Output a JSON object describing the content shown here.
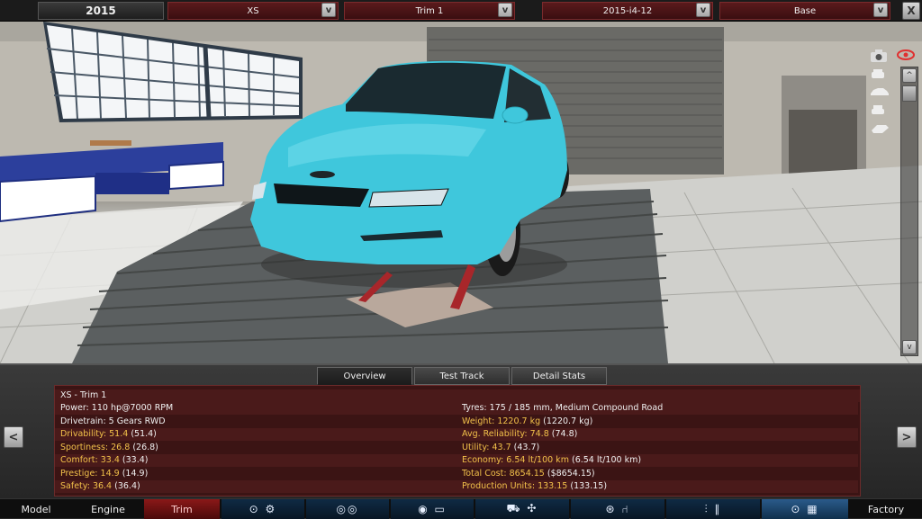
{
  "top_bar": {
    "year": "2015",
    "model": "XS",
    "trim": "Trim 1",
    "engine": "2015-i4-12",
    "variant": "Base",
    "dropdown_glyph": "v",
    "close_glyph": "X"
  },
  "side_tools": {
    "icons": [
      "camera-icon",
      "eye-icon",
      "car-front-icon",
      "car-side-icon",
      "car-front-icon",
      "car-top-icon",
      "close-icon"
    ],
    "scroll_up": "^",
    "scroll_down": "v"
  },
  "tabs": [
    "Overview",
    "Test Track",
    "Detail Stats"
  ],
  "active_tab": "Overview",
  "stats": {
    "title": "XS - Trim 1",
    "left": [
      {
        "label": "Power:",
        "value": "110 hp@7000 RPM",
        "hi": false
      },
      {
        "label": "Drivetrain:",
        "value": "5 Gears RWD",
        "hi": false
      },
      {
        "label": "Drivability:",
        "value": "51.4",
        "extra": "(51.4)",
        "hi": true
      },
      {
        "label": "Sportiness:",
        "value": "26.8",
        "extra": "(26.8)",
        "hi": true
      },
      {
        "label": "Comfort:",
        "value": "33.4",
        "extra": "(33.4)",
        "hi": true
      },
      {
        "label": "Prestige:",
        "value": "14.9",
        "extra": "(14.9)",
        "hi": true
      },
      {
        "label": "Safety:",
        "value": "36.4",
        "extra": "(36.4)",
        "hi": true
      }
    ],
    "right": [
      {
        "label": "Tyres:",
        "value": "175 / 185 mm, Medium Compound Road",
        "hi": false
      },
      {
        "label": "Weight:",
        "value": "1220.7 kg",
        "extra": "(1220.7 kg)",
        "hi": true
      },
      {
        "label": "Avg. Reliability:",
        "value": "74.8",
        "extra": "(74.8)",
        "hi": true
      },
      {
        "label": "Utility:",
        "value": "43.7",
        "extra": "(43.7)",
        "hi": true
      },
      {
        "label": "Economy:",
        "value": "6.54 lt/100 km",
        "extra": "(6.54 lt/100 km)",
        "hi": true
      },
      {
        "label": "Total Cost:",
        "value": "8654.15",
        "extra": "($8654.15)",
        "hi": true
      },
      {
        "label": "Production Units:",
        "value": "133.15",
        "extra": "(133.15)",
        "hi": true
      }
    ]
  },
  "nav_arrows": {
    "prev": "<",
    "next": ">"
  },
  "bottom_nav": {
    "model": "Model",
    "engine": "Engine",
    "trim": "Trim",
    "factory": "Factory",
    "icon_groups": [
      "gearbox-icons",
      "wheels-icons",
      "body-icons",
      "interior-icons",
      "suspension-icons",
      "testing-icons"
    ]
  },
  "colors": {
    "car_body": "#3fc7dc",
    "active_nav": "#8a1818",
    "stat_highlight": "#f2c14a"
  }
}
